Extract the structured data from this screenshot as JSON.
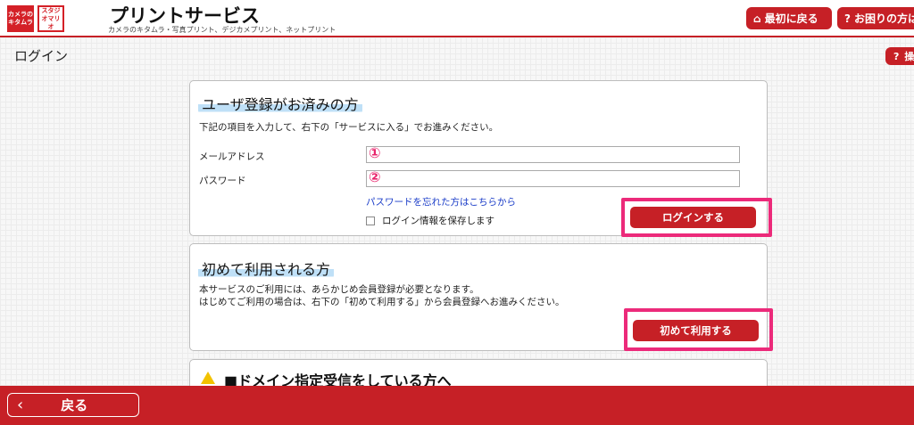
{
  "header": {
    "logo1_text": "カメラのキタムラ",
    "logo2_text": "スタジオマリオ",
    "title": "プリントサービス",
    "subtitle": "カメラのキタムラ・写真プリント、デジカメプリント、ネットプリント",
    "home_button": "最初に戻る",
    "help_button": "お困りの方は"
  },
  "page": {
    "title": "ログイン",
    "side_help_label": "操"
  },
  "login_card": {
    "title": "ユーザ登録がお済みの方",
    "description": "下記の項目を入力して、右下の「サービスに入る」でお進みください。",
    "email_label": "メールアドレス",
    "email_value": "",
    "password_label": "パスワード",
    "password_value": "",
    "badge_1": "①",
    "badge_2": "②",
    "forgot_link": "パスワードを忘れた方はこちらから",
    "remember_label": "ログイン情報を保存します",
    "login_button": "ログインする"
  },
  "new_card": {
    "title": "初めて利用される方",
    "description_line1": "本サービスのご利用には、あらかじめ会員登録が必要となります。",
    "description_line2": "はじめてご利用の場合は、右下の「初めて利用する」から会員登録へお進みください。",
    "start_button": "初めて利用する"
  },
  "notice_card": {
    "title": "■ドメイン指定受信をしている方へ"
  },
  "footer": {
    "back_button": "戻る"
  },
  "colors": {
    "brand_red": "#c62026",
    "highlight_pink": "#ec2a7a",
    "title_marker_blue": "#bfe0f7",
    "link_blue": "#1a3cc8"
  }
}
